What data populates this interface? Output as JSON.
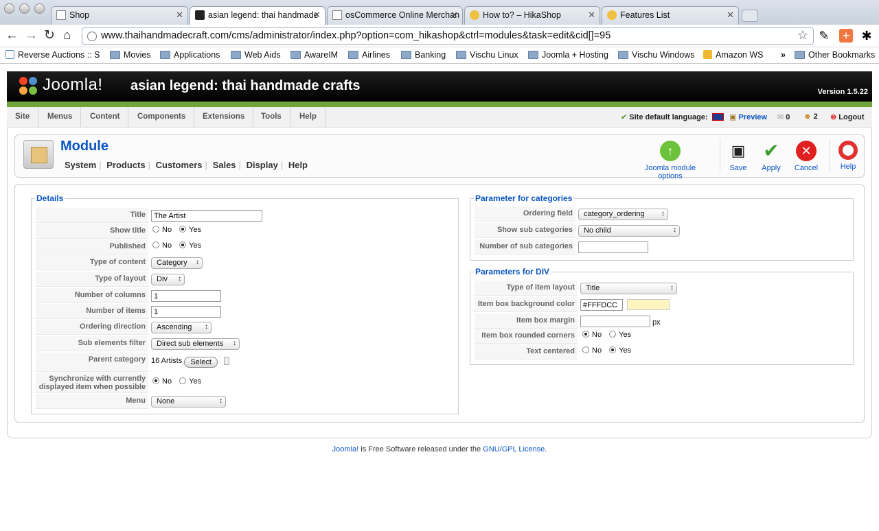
{
  "browser": {
    "tabs": [
      {
        "title": "Shop"
      },
      {
        "title": "asian legend: thai handmade"
      },
      {
        "title": "osCommerce Online Merchan"
      },
      {
        "title": "How to? – HikaShop"
      },
      {
        "title": "Features List"
      }
    ],
    "url": "www.thaihandmadecraft.com/cms/administrator/index.php?option=com_hikashop&ctrl=modules&task=edit&cid[]=95",
    "bookmarks": [
      {
        "label": "Reverse Auctions :: S"
      },
      {
        "label": "Movies"
      },
      {
        "label": "Applications"
      },
      {
        "label": "Web Aids"
      },
      {
        "label": "AwareIM"
      },
      {
        "label": "Airlines"
      },
      {
        "label": "Banking"
      },
      {
        "label": "Vischu Linux"
      },
      {
        "label": "Joomla + Hosting"
      },
      {
        "label": "Vischu Windows"
      },
      {
        "label": "Amazon WS"
      }
    ],
    "overflow": "»",
    "other_bookmarks": "Other Bookmarks"
  },
  "joomla": {
    "logo_text": "Joomla!",
    "site_title": "asian legend: thai handmade crafts",
    "version": "Version 1.5.22",
    "menu": [
      "Site",
      "Menus",
      "Content",
      "Components",
      "Extensions",
      "Tools",
      "Help"
    ],
    "status": {
      "language_label": "Site default language:",
      "preview": "Preview",
      "messages": "0",
      "users": "2",
      "logout": "Logout"
    }
  },
  "toolbar": {
    "title": "Module",
    "submenu": [
      "System",
      "Products",
      "Customers",
      "Sales",
      "Display",
      "Help"
    ],
    "buttons": {
      "options": "Joomla module options",
      "save": "Save",
      "apply": "Apply",
      "cancel": "Cancel",
      "help": "Help"
    }
  },
  "details": {
    "legend": "Details",
    "title_label": "Title",
    "title_value": "The Artist",
    "show_title_label": "Show title",
    "published_label": "Published",
    "type_content_label": "Type of content",
    "type_content_value": "Category",
    "type_layout_label": "Type of layout",
    "type_layout_value": "Div",
    "columns_label": "Number of columns",
    "columns_value": "1",
    "items_label": "Number of items",
    "items_value": "1",
    "ordering_dir_label": "Ordering direction",
    "ordering_dir_value": "Ascending",
    "sub_filter_label": "Sub elements filter",
    "sub_filter_value": "Direct sub elements",
    "parent_label": "Parent category",
    "parent_value": "16 Artists",
    "select_button": "Select",
    "sync_label_1": "Synchronize with currently",
    "sync_label_2": "displayed item when possible",
    "menu_label": "Menu",
    "menu_value": "None",
    "no": "No",
    "yes": "Yes"
  },
  "categories": {
    "legend": "Parameter for categories",
    "ordering_label": "Ordering field",
    "ordering_value": "category_ordering",
    "show_sub_label": "Show sub categories",
    "show_sub_value": "No child",
    "num_sub_label": "Number of sub categories",
    "num_sub_value": ""
  },
  "div": {
    "legend": "Parameters for DIV",
    "item_layout_label": "Type of item layout",
    "item_layout_value": "Title",
    "bg_label": "Item box background color",
    "bg_value": "#FFFDCC",
    "bg_color": "#FFF5C0",
    "margin_label": "Item box margin",
    "margin_value": "",
    "margin_unit": "px",
    "rounded_label": "Item box rounded corners",
    "centered_label": "Text centered"
  },
  "footer": {
    "link1": "Joomla!",
    "text": " is Free Software released under the ",
    "link2": "GNU/GPL License",
    "end": "."
  }
}
